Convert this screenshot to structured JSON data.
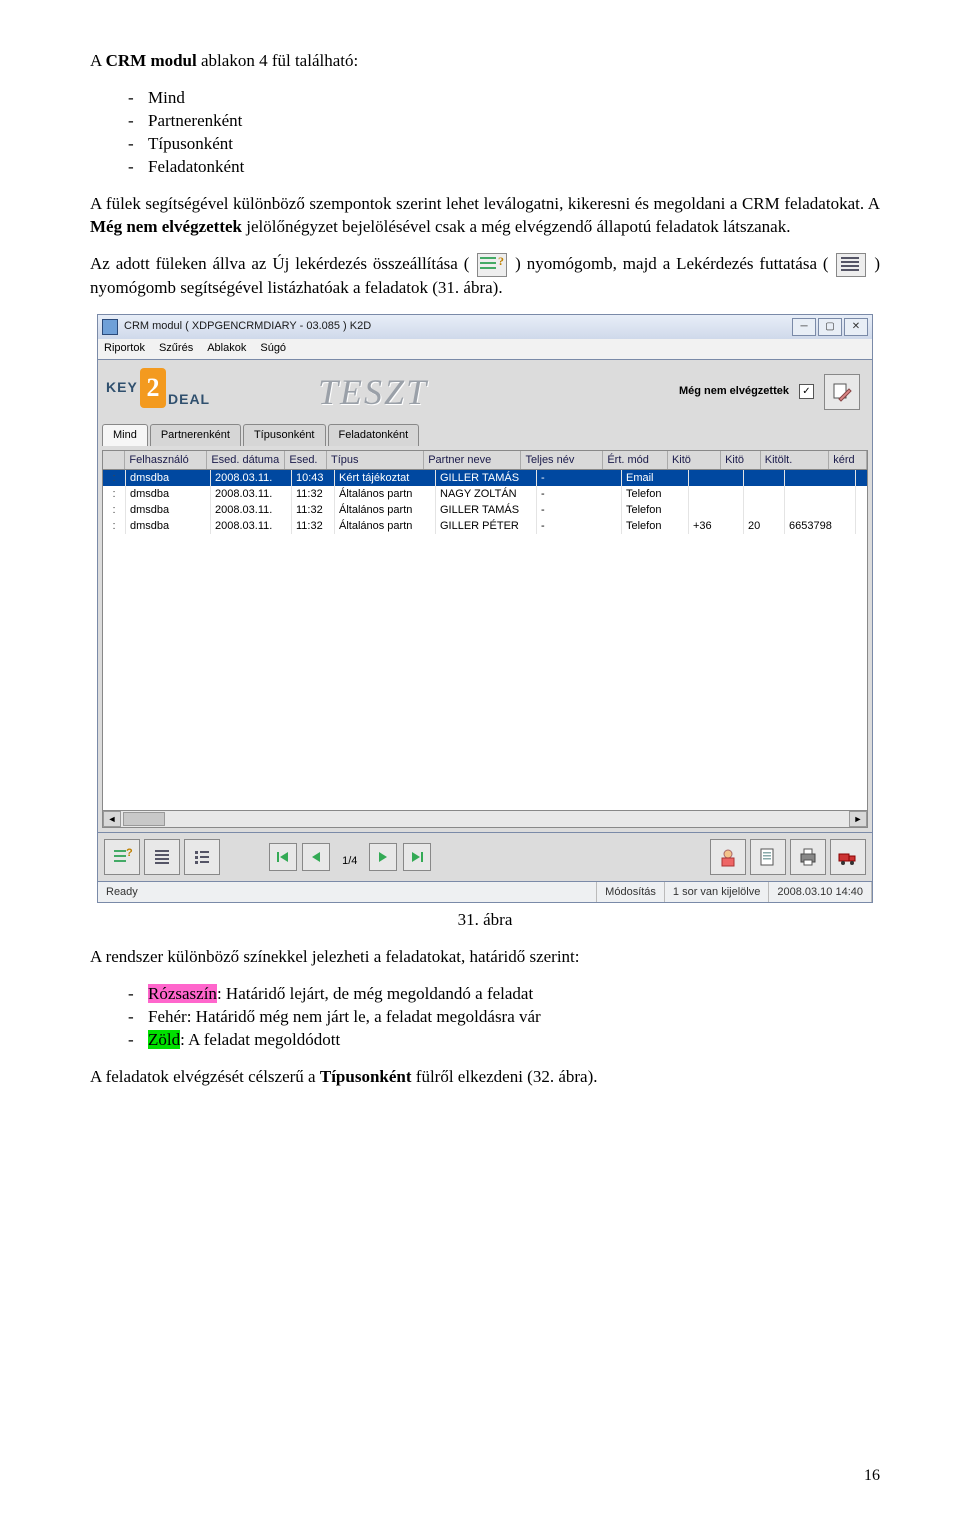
{
  "p1": {
    "bold": "CRM modul",
    "rest": " ablakon 4 fül található:"
  },
  "list1": [
    "Mind",
    "Partnerenként",
    "Típusonként",
    "Feladatonként"
  ],
  "p2": {
    "a": "A fülek segítségével különböző szempontok szerint lehet leválogatni, kikeresni és megoldani a CRM feladatokat. A ",
    "b": "Még nem elvégzettek",
    "c": " jelölőnégyzet bejelölésével csak a még elvégzendő állapotú feladatok látszanak."
  },
  "p3": {
    "a": "Az adott füleken állva az Új lekérdezés összeállítása (",
    "b": ") nyomógomb, majd a Lekérdezés futtatása (",
    "c": ") nyomógomb segítségével listázhatóak a feladatok (31. ábra)."
  },
  "win": {
    "title": "CRM modul ( XDPGENCRMDIARY - 03.085 )      K2D",
    "menu": [
      "Riportok",
      "Szűrés",
      "Ablakok",
      "Súgó"
    ],
    "logo": {
      "key": "KEY",
      "two": "2",
      "deal": "DEAL"
    },
    "teszt": "TESZT",
    "chk_label": "Még nem elvégzettek",
    "tabs": [
      "Mind",
      "Partnerenként",
      "Típusonként",
      "Feladatonként"
    ],
    "cols": [
      "Felhasználó",
      "Esed. dátuma",
      "Esed.",
      "Típus",
      "Partner neve",
      "Teljes név",
      "Ért. mód",
      "Kitö",
      "Kitö",
      "Kitölt.",
      "kérd"
    ],
    "rows": [
      [
        "dmsdba",
        "2008.03.11.",
        "10:43",
        "Kért tájékoztat",
        "GILLER TAMÁS",
        "-",
        "Email",
        "",
        "",
        "",
        ""
      ],
      [
        "dmsdba",
        "2008.03.11.",
        "11:32",
        "Általános partn",
        "NAGY   ZOLTÁN",
        "-",
        "Telefon",
        "",
        "",
        "",
        ""
      ],
      [
        "dmsdba",
        "2008.03.11.",
        "11:32",
        "Általános partn",
        "GILLER TAMÁS",
        "-",
        "Telefon",
        "",
        "",
        "",
        ""
      ],
      [
        "dmsdba",
        "2008.03.11.",
        "11:32",
        "Általános partn",
        "GILLER PÉTER",
        "-",
        "Telefon",
        "+36",
        "20",
        "6653798",
        ""
      ]
    ],
    "pager": "1/4",
    "status": {
      "ready": "Ready",
      "mode": "Módosítás",
      "sel": "1 sor van kijelölve",
      "dt": "2008.03.10 14:40"
    }
  },
  "fig_caption": "31. ábra",
  "p4": "A rendszer különböző színekkel jelezheti a feladatokat, határidő szerint:",
  "colors": {
    "pink": {
      "label": "Rózsaszín",
      "rest": ": Határidő lejárt, de még megoldandó a feladat"
    },
    "white": "Fehér: Határidő még nem járt le, a feladat megoldásra vár",
    "green": {
      "label": "Zöld",
      "rest": ": A feladat megoldódott"
    }
  },
  "p5": {
    "a": "A feladatok elvégzését célszerű a ",
    "b": "Típusonként",
    "c": " fülről elkezdeni (32. ábra)."
  },
  "page_number": "16"
}
